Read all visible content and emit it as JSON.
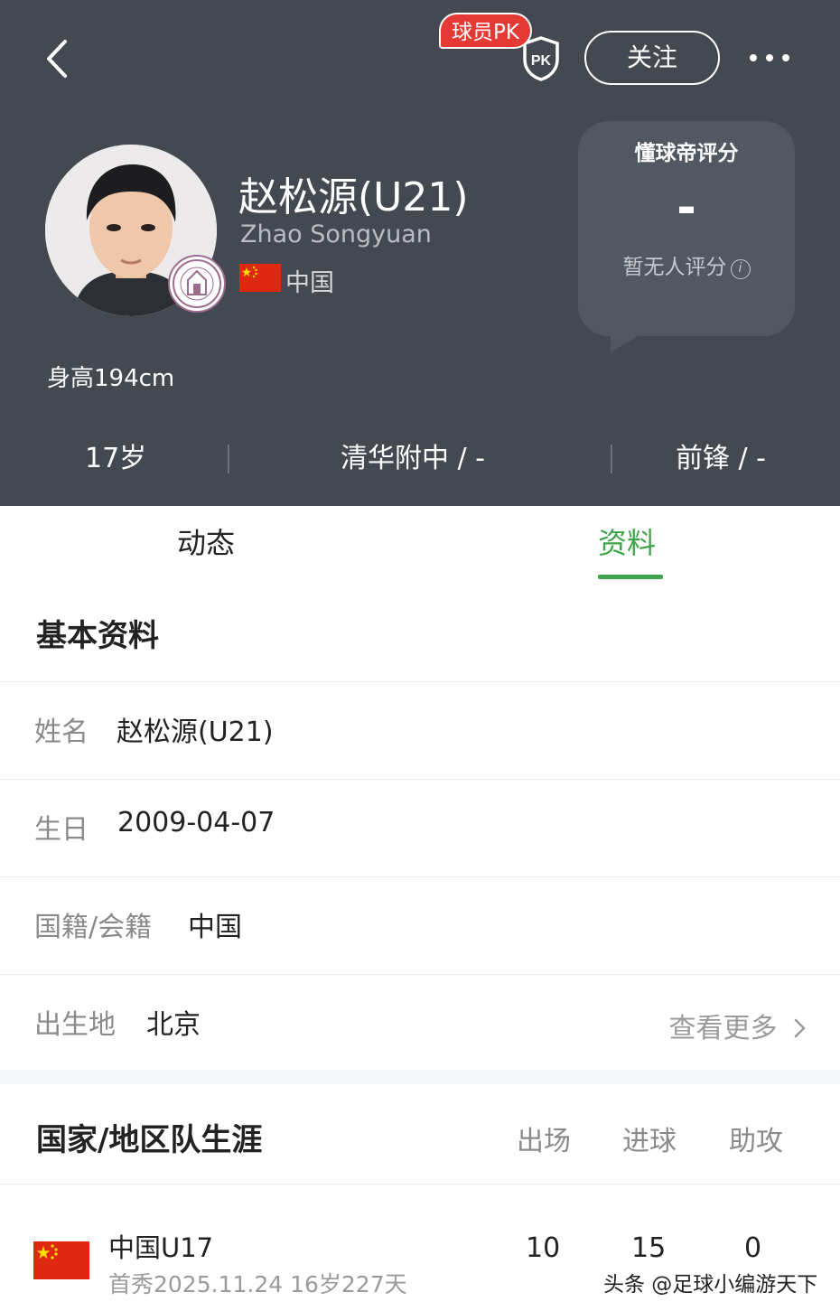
{
  "header": {
    "pk_badge": "球员PK",
    "follow_label": "关注",
    "player_name": "赵松源(U21)",
    "player_name_en": "Zhao Songyuan",
    "nationality": "中国",
    "rating": {
      "title": "懂球帝评分",
      "value": "-",
      "note": "暂无人评分"
    },
    "height": "身高194cm",
    "stats": {
      "age": "17岁",
      "club": "清华附中 / -",
      "position": "前锋 / -"
    }
  },
  "tabs": [
    {
      "label": "动态",
      "active": false
    },
    {
      "label": "资料",
      "active": true
    }
  ],
  "basic_info": {
    "title": "基本资料",
    "rows": [
      {
        "label": "姓名",
        "value": "赵松源(U21)"
      },
      {
        "label": "生日",
        "value": "2009-04-07"
      },
      {
        "label": "国籍/会籍",
        "value": "中国"
      },
      {
        "label": "出生地",
        "value": "北京"
      }
    ],
    "more_label": "查看更多"
  },
  "national_career": {
    "title": "国家/地区队生涯",
    "columns": [
      "出场",
      "进球",
      "助攻"
    ],
    "rows": [
      {
        "team": "中国U17",
        "debut": "首秀2025.11.24 16岁227天",
        "appearances": "10",
        "goals": "15",
        "assists": "0"
      }
    ]
  },
  "watermark": "头条 @足球小编游天下",
  "colors": {
    "header_bg": "#434851",
    "accent_green": "#3ea44a",
    "pk_red": "#e53935",
    "flag_red": "#de2910"
  },
  "icons": {
    "back": "chevron-left-icon",
    "pk": "pk-shield-icon",
    "more": "more-dots-icon",
    "info": "info-icon",
    "more_link": "chevron-right-icon"
  }
}
